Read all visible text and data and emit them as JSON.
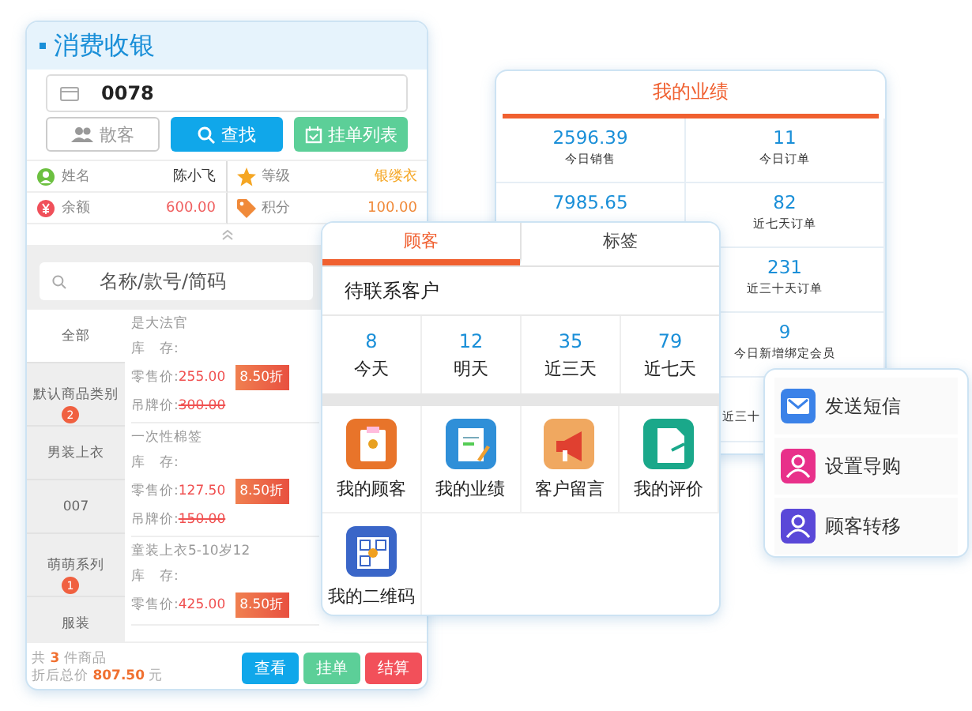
{
  "checkout": {
    "title": "消费收银",
    "member_code": "0078",
    "buttons": [
      {
        "label": "散客",
        "kind": "outline"
      },
      {
        "label": "查找",
        "kind": "primary"
      },
      {
        "label": "挂单列表",
        "kind": "success"
      }
    ],
    "info": [
      {
        "kind": "person",
        "label": "姓名",
        "value": "陈小飞"
      },
      {
        "kind": "star",
        "label": "等级",
        "value": "银缕衣"
      },
      {
        "kind": "yuan",
        "label": "余额",
        "value": "600.00"
      },
      {
        "kind": "tag",
        "label": "积分",
        "value": "100.00"
      }
    ],
    "search": {
      "placeholder": "名称/款号/简码"
    },
    "categories": [
      {
        "name": "全部",
        "selected": true
      },
      {
        "name": "默认商品类别",
        "badge": "2",
        "selected": false
      },
      {
        "name": "男装上衣",
        "selected": false
      },
      {
        "name": "007",
        "selected": false
      },
      {
        "name": "萌萌系列",
        "badge": "1",
        "selected": false
      },
      {
        "name": "服装",
        "selected": false
      }
    ],
    "products": [
      {
        "name": "是大法官",
        "stock_label": "库　存:",
        "price_label": "零售价:",
        "price": "255.00",
        "discount": "8.50折",
        "tag_label": "吊牌价:",
        "tag_price": "300.00"
      },
      {
        "name": "一次性棉签",
        "stock_label": "库　存:",
        "price_label": "零售价:",
        "price": "127.50",
        "discount": "8.50折",
        "tag_label": "吊牌价:",
        "tag_price": "150.00"
      },
      {
        "name": "童装上衣5-10岁12",
        "stock_label": "库　存:",
        "price_label": "零售价:",
        "price": "425.00",
        "discount": "8.50折"
      }
    ],
    "summary": [
      {
        "pre": "共 ",
        "value": "3",
        "post": " 件商品"
      },
      {
        "pre": "折后总价 ",
        "value": "807.50",
        "post": " 元"
      }
    ],
    "actions": [
      {
        "label": "查看",
        "kind": "primary"
      },
      {
        "label": "挂单",
        "kind": "success"
      },
      {
        "label": "结算",
        "kind": "danger"
      }
    ]
  },
  "performance": {
    "title": "我的业绩",
    "rows": [
      {
        "left": {
          "value": "2596.39",
          "label": "今日销售"
        },
        "right": {
          "value": "11",
          "label": "今日订单"
        }
      },
      {
        "left": {
          "value": "7985.65"
        },
        "right": {
          "value": "82",
          "label": "近七天订单"
        }
      },
      {
        "right": {
          "value": "231",
          "label": "近三十天订单"
        }
      },
      {
        "right": {
          "value": "9",
          "label": "今日新增绑定会员"
        }
      },
      {
        "right": {
          "label": "近三十"
        }
      }
    ]
  },
  "customers": {
    "tabs": [
      {
        "label": "顾客",
        "selected": true
      },
      {
        "label": "标签",
        "selected": false
      }
    ],
    "section_title": "待联系客户",
    "stats": [
      {
        "value": "8",
        "label": "今天"
      },
      {
        "value": "12",
        "label": "明天"
      },
      {
        "value": "35",
        "label": "近三天"
      },
      {
        "value": "79",
        "label": "近七天"
      }
    ],
    "shortcuts": [
      {
        "label": "我的顾客",
        "kind": "clipboard",
        "color": "#e8742a"
      },
      {
        "label": "我的业绩",
        "kind": "document",
        "color": "#2f8fd8"
      },
      {
        "label": "客户留言",
        "kind": "megaphone",
        "color": "#f0a860"
      },
      {
        "label": "我的评价",
        "kind": "page",
        "color": "#1aa88a"
      },
      {
        "label": "我的二维码",
        "kind": "qr",
        "color": "#3a66c8"
      }
    ]
  },
  "quick_menu": [
    {
      "label": "发送短信",
      "kind": "envelope",
      "color": "#3b82e8"
    },
    {
      "label": "设置导购",
      "kind": "person",
      "color": "#e8308a"
    },
    {
      "label": "顾客转移",
      "kind": "person",
      "color": "#5a48d8"
    }
  ]
}
